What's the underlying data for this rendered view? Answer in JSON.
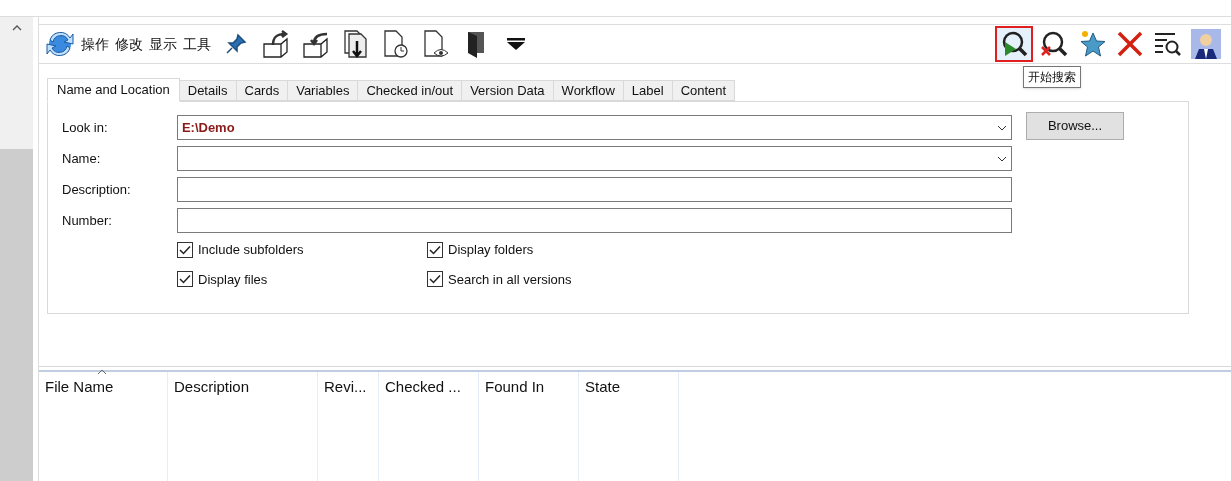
{
  "toolbar": {
    "menus": [
      "操作",
      "修改",
      "显示",
      "工具"
    ],
    "right_buttons": [
      {
        "kind": "search-start",
        "highlighted": true
      },
      {
        "kind": "search-clear",
        "highlighted": false
      },
      {
        "kind": "favorite",
        "highlighted": false
      },
      {
        "kind": "close",
        "highlighted": false
      },
      {
        "kind": "search-list",
        "highlighted": false
      },
      {
        "kind": "user",
        "highlighted": false
      }
    ],
    "tooltip": "开始搜索"
  },
  "tabs": [
    {
      "label": "Name and Location",
      "selected": true
    },
    {
      "label": "Details",
      "selected": false
    },
    {
      "label": "Cards",
      "selected": false
    },
    {
      "label": "Variables",
      "selected": false
    },
    {
      "label": "Checked in/out",
      "selected": false
    },
    {
      "label": "Version Data",
      "selected": false
    },
    {
      "label": "Workflow",
      "selected": false
    },
    {
      "label": "Label",
      "selected": false
    },
    {
      "label": "Content",
      "selected": false
    }
  ],
  "fields": [
    {
      "label": "Look in:",
      "value": "E:\\Demo",
      "kind": "dropdown"
    },
    {
      "label": "Name:",
      "kind": "dropdown"
    },
    {
      "label": "Description:",
      "kind": "text"
    },
    {
      "label": "Number:",
      "kind": "text"
    }
  ],
  "browse_button": "Browse...",
  "checkboxes": [
    {
      "label": "Include subfolders",
      "checked": true
    },
    {
      "label": "Display folders",
      "checked": true
    },
    {
      "label": "Display files",
      "checked": true
    },
    {
      "label": "Search in all versions",
      "checked": true
    }
  ],
  "table": {
    "columns": [
      {
        "label": "File Name",
        "sorted": true
      },
      {
        "label": "Description",
        "sorted": false
      },
      {
        "label": "Revi...",
        "sorted": false
      },
      {
        "label": "Checked ...",
        "sorted": false
      },
      {
        "label": "Found In",
        "sorted": false
      },
      {
        "label": "State",
        "sorted": false
      }
    ]
  }
}
